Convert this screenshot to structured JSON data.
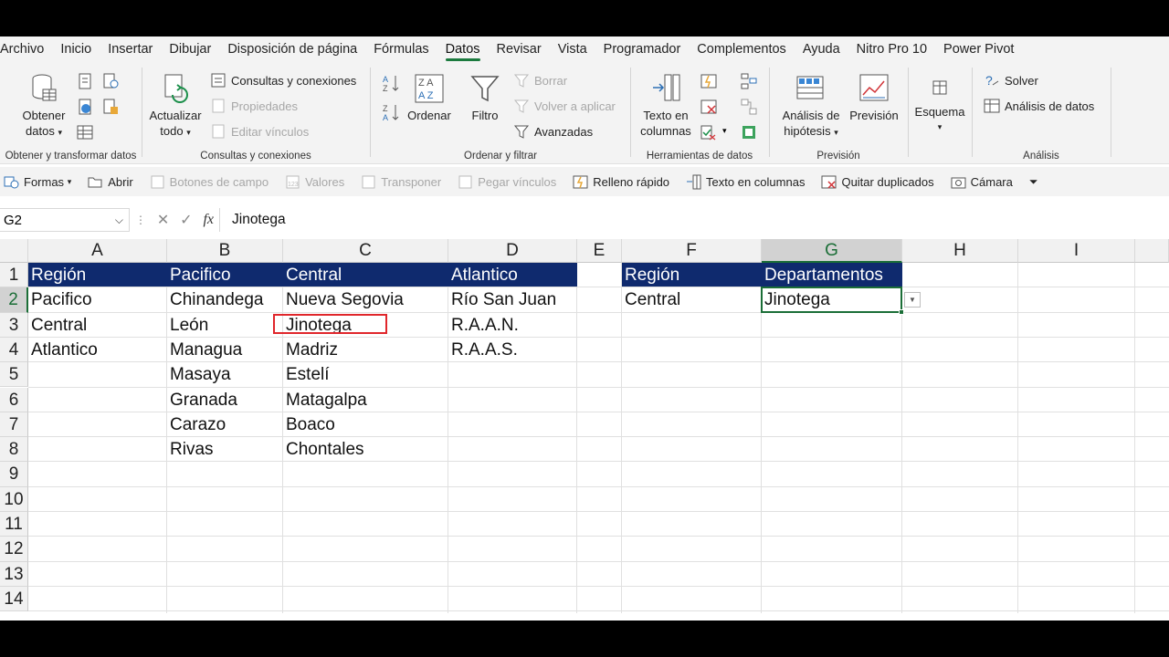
{
  "tabs": [
    "Archivo",
    "Inicio",
    "Insertar",
    "Dibujar",
    "Disposición de página",
    "Fórmulas",
    "Datos",
    "Revisar",
    "Vista",
    "Programador",
    "Complementos",
    "Ayuda",
    "Nitro Pro 10",
    "Power Pivot"
  ],
  "ribbon": {
    "get_data": {
      "label1": "Obtener",
      "label2": "datos",
      "group": "Obtener y transformar datos"
    },
    "queries": {
      "refresh1": "Actualizar",
      "refresh2": "todo",
      "queries_connections": "Consultas y conexiones",
      "properties": "Propiedades",
      "edit_links": "Editar vínculos",
      "group": "Consultas y conexiones"
    },
    "sort": {
      "sort": "Ordenar",
      "filter": "Filtro",
      "clear": "Borrar",
      "reapply": "Volver a aplicar",
      "advanced": "Avanzadas",
      "group": "Ordenar y filtrar"
    },
    "tools": {
      "text1": "Texto en",
      "text2": "columnas",
      "group": "Herramientas de datos"
    },
    "forecast": {
      "whatif1": "Análisis de",
      "whatif2": "hipótesis",
      "forecast": "Previsión",
      "group": "Previsión"
    },
    "outline": {
      "label": "Esquema"
    },
    "analysis": {
      "solver": "Solver",
      "data_analysis": "Análisis de datos",
      "group": "Análisis"
    }
  },
  "qat": [
    "Formas",
    "Abrir",
    "Botones de campo",
    "Valores",
    "Transponer",
    "Pegar vínculos",
    "Relleno rápido",
    "Texto en columnas",
    "Quitar duplicados",
    "Cámara"
  ],
  "formula_bar": {
    "name_box": "G2",
    "fx": "fx",
    "value": "Jinotega"
  },
  "columns": [
    "A",
    "B",
    "C",
    "D",
    "E",
    "F",
    "G",
    "H",
    "I"
  ],
  "rows": [
    "1",
    "2",
    "3",
    "4",
    "5",
    "6",
    "7",
    "8",
    "9",
    "10",
    "11",
    "12",
    "13",
    "14"
  ],
  "cells": {
    "A1": "Región",
    "B1": "Pacifico",
    "C1": "Central",
    "D1": "Atlantico",
    "A2": "Pacifico",
    "B2": "Chinandega",
    "C2": "Nueva Segovia",
    "D2": "Río San Juan",
    "A3": "Central",
    "B3": "León",
    "C3": "Jinotega",
    "D3": "R.A.A.N.",
    "A4": "Atlantico",
    "B4": "Managua",
    "C4": "Madriz",
    "D4": "R.A.A.S.",
    "B5": "Masaya",
    "C5": "Estelí",
    "B6": "Granada",
    "C6": "Matagalpa",
    "B7": "Carazo",
    "C7": "Boaco",
    "B8": "Rivas",
    "C8": "Chontales",
    "F1": "Región",
    "G1": "Departamentos",
    "F2": "Central",
    "G2": "Jinotega"
  },
  "colors": {
    "header_fill": "#0f2a6e",
    "accent": "#1b6e37",
    "highlight": "#e0262b"
  }
}
